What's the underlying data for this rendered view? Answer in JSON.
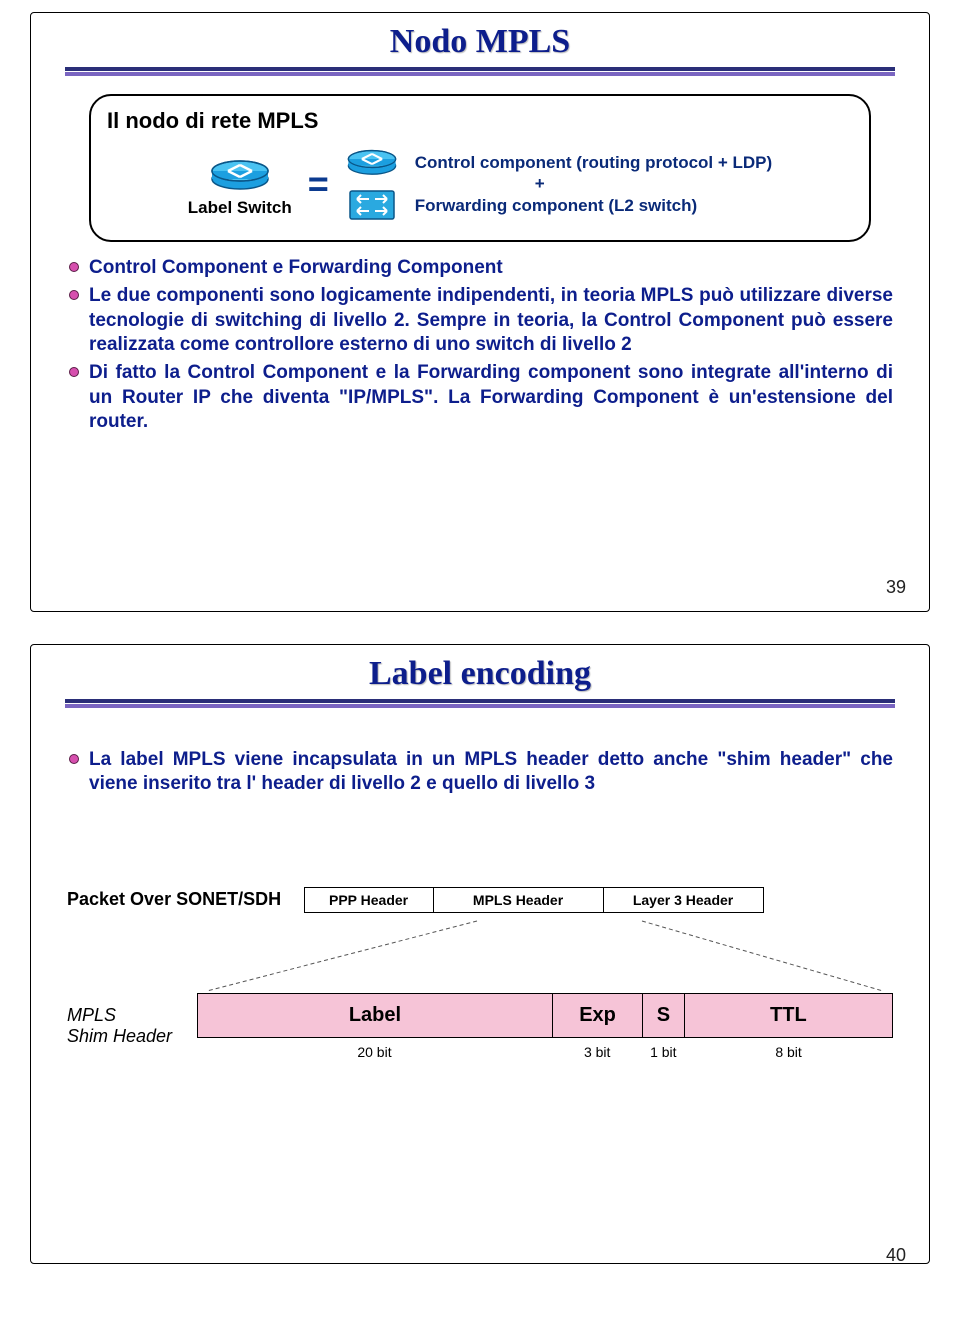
{
  "slide1": {
    "title": "Nodo MPLS",
    "diagram": {
      "heading": "Il nodo di rete MPLS",
      "labelSwitch": "Label Switch",
      "equals": "=",
      "line1": "Control component (routing protocol + LDP)",
      "plus": "+",
      "line2": "Forwarding component (L2 switch)"
    },
    "bullets": [
      "Control Component e Forwarding Component",
      "Le due componenti sono logicamente indipendenti, in teoria MPLS può utilizzare diverse tecnologie di switching di livello 2. Sempre in teoria, la Control Component può essere realizzata come controllore esterno di uno switch di livello 2",
      "Di fatto la Control Component e la Forwarding component sono integrate all'interno di un Router IP che diventa \"IP/MPLS\". La Forwarding Component è un'estensione del router."
    ],
    "number": "39"
  },
  "slide2": {
    "title": "Label encoding",
    "bullet": "La label MPLS viene incapsulata in un MPLS header detto anche \"shim header\" che viene inserito tra l' header di livello 2 e quello di livello 3",
    "packetRow": {
      "label": "Packet Over SONET/SDH",
      "headers": [
        "PPP Header",
        "MPLS Header",
        "Layer 3 Header"
      ]
    },
    "shim": {
      "label": "MPLS\nShim Header",
      "cells": [
        "Label",
        "Exp",
        "S",
        "TTL"
      ],
      "bits": [
        "20 bit",
        "3 bit",
        "1 bit",
        "8 bit"
      ]
    },
    "number": "40"
  }
}
